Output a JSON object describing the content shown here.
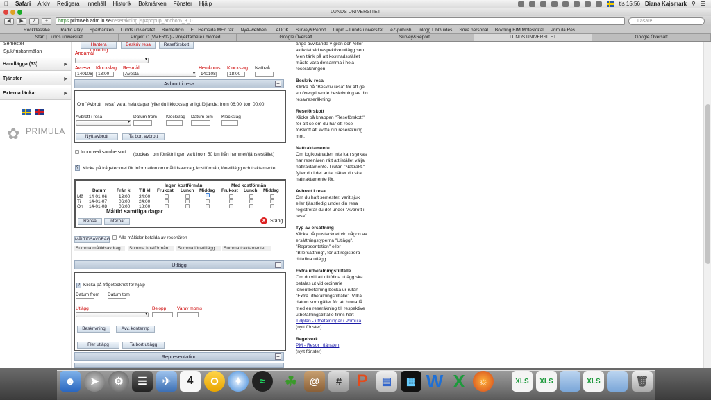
{
  "menubar": {
    "apple": "",
    "items": [
      "Safari",
      "Arkiv",
      "Redigera",
      "Innehåll",
      "Historik",
      "Bokmärken",
      "Fönster",
      "Hjälp"
    ],
    "clock": "tis 15:56",
    "user": "Diana Kajsmark"
  },
  "window": {
    "title": "LUNDS UNIVERSITET"
  },
  "toolbar": {
    "url_scheme": "https",
    "url_host": "primweb.adm.lu.se",
    "url_path": "/reseräkning.jsp#popup_anchor6_3_0",
    "search_placeholder": "Läsare"
  },
  "bookmarks": [
    "Rockklassike...",
    "Radio Play",
    "Sparbanken",
    "Lunds universitet",
    "Biomedicin",
    "FU Hemsida MEd fak",
    "NyA-webben",
    "LADOK",
    "Survey&Report",
    "Lupin – Lunds universitet",
    "eZ-publish",
    "Inlogg LibGuides",
    "Söka personal",
    "Bokning BIM Möteslokal",
    "Primula Res"
  ],
  "tabs": [
    "Start | Lunds universitet",
    "Projekt C (VMFR12) - Projektarbete i biomed...",
    "Google Översätt",
    "Survey&Report",
    "LUNDS UNIVERSITET",
    "Google Översätt"
  ],
  "sidebar": {
    "items": [
      "Semester",
      "Sjuk/friskanmälan"
    ],
    "heads": [
      "Handlägga (33)",
      "Tjänster",
      "Externa länkar"
    ],
    "logo": "PRIMULA"
  },
  "form": {
    "top_buttons": [
      "Hantera kontering",
      "Beskriv resa",
      "Reseförskott"
    ],
    "andamal_label": "Ändamål",
    "labels": {
      "avresa": "Avresa",
      "klockslag1": "Klockslag",
      "resmal": "Resmål",
      "hemkomst": "Hemkomst",
      "klockslag2": "Klockslag",
      "nattrakt": "Nattrakt."
    },
    "values": {
      "avresa": "140106",
      "klockslag1": "13:00",
      "resmal": "Avesta",
      "hemkomst": "140108",
      "klockslag2": "18:00"
    },
    "avbrott": {
      "title": "Avbrott i resa",
      "info": "Om \"Avbrott i resa\" varat hela dagar fyller du i klockslag enligt följande: from 06:00, tom 00:00.",
      "labels": [
        "Avbrott i resa",
        "Datum from",
        "Klockslag",
        "Datum tom",
        "Klockslag"
      ],
      "buttons": [
        "Nytt avbrott",
        "Ta bort avbrott"
      ]
    },
    "verksamhet": "Inom verksamhetsort",
    "verksamhet_note": "(bockas i om förrättningen varit inom 50 km från hemmet/tjänstestället)",
    "help_note": "Klicka på frågetecknet för information om måltidsavdrag, kostförmån, lönetillägg och traktamente.",
    "meals": {
      "group1": "Ingen kostförmån",
      "group2": "Med kostförmån",
      "headers": [
        "Datum",
        "Från kl",
        "Till kl",
        "Frukost",
        "Lunch",
        "Middag",
        "Frukost",
        "Lunch",
        "Middag"
      ],
      "rows": [
        {
          "day": "Må",
          "date": "14-01-06",
          "from": "13:00",
          "to": "24:00"
        },
        {
          "day": "Ti",
          "date": "14-01-07",
          "from": "06:00",
          "to": "24:00"
        },
        {
          "day": "On",
          "date": "14-01-08",
          "from": "06:00",
          "to": "18:00"
        }
      ],
      "all_days": "Måltid samtliga dagar",
      "buttons": [
        "Rensa",
        "Internat"
      ],
      "close": "Stäng"
    },
    "maltidsavdrag_btn": "MÅLTIDSAVDRAG",
    "alla_maltider": "Alla måltider betalda av resenären",
    "sums": [
      "Summa måltidsavdrag",
      "Summa kostförmån",
      "Summa lönetillägg",
      "Summa traktamente"
    ],
    "utlagg": {
      "title": "Utlägg",
      "help": "Klicka på frågetecknet för hjälp",
      "labels": [
        "Datum from",
        "Datum tom",
        "Utlägg",
        "Belopp",
        "Varav moms"
      ],
      "buttons": [
        "Beskrivning",
        "Avv. kontering",
        "Fler utlägg",
        "Ta bort utlägg"
      ]
    },
    "representation": "Representation"
  },
  "help_panel": {
    "intro": "ange avvikande v-gren och /eller aktivitet vid respektive utlägg sen. Men tänk på att kostnadsstället måste vara detsamma i hela reseräkningen.",
    "sections": [
      {
        "title": "Beskriv resa",
        "text": "Klicka på \"Beskriv resa\" för att ge en övergripande beskrivning av din resa/reseräkning."
      },
      {
        "title": "Reseförskott",
        "text": "Klicka på knappen \"Reseförskott\" för att se om du har ett rese-förskott att kvitta din reseräkning mot."
      },
      {
        "title": "Nattraktamente",
        "text": "Om logikostnaden inte kan styrkas har resenären rätt att istället välja nattraktamente. I rutan \"Nattrakt.\" fyller du i det antal nätter du ska nattraktamente för."
      },
      {
        "title": "Avbrott i resa",
        "text": "Om du haft semester, varit sjuk eller tjänstledig under din resa registrerar du det under \"Avbrott i resa\"."
      },
      {
        "title": "Typ av ersättning",
        "text": "Klicka på plustecknet vid någon av ersättningstyperna \"Utlägg\", \"Representation\" eller \"Bilersättning\", för att registrera ditt/dina utlägg."
      },
      {
        "title": "Extra utbetalningstillfälle",
        "text": "Om du vill att ditt/dina utlägg ska betalas ut vid ordinarie löneutbetalning bocka ur rutan \"Extra utbetalningstillfälle\". Vilka datum som gäller för att hinna få med en reseräkning till respektive utbetalningstillfälle finns här:"
      }
    ],
    "link1": "Tidplan - utbetalningar i Primula",
    "link1_note": "(nytt fönster)",
    "regelverk": "Regelverk",
    "link2": "PM - Resor i tjänsten",
    "link2_note": "(nytt fönster)"
  },
  "dock": {
    "calendar_day": "4"
  }
}
